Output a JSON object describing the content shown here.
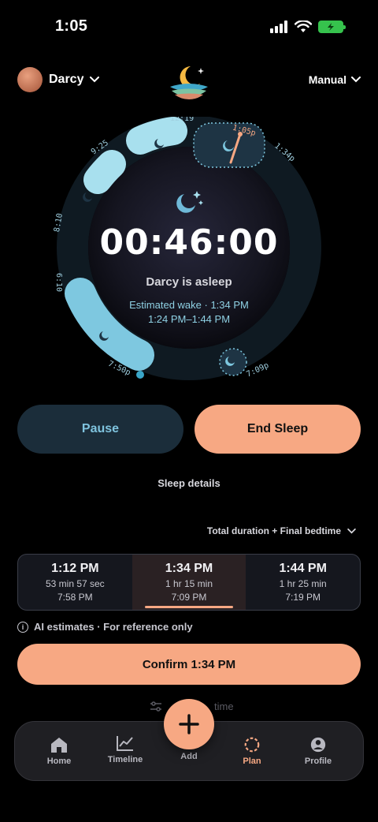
{
  "status_bar": {
    "time": "1:05"
  },
  "header": {
    "user_name": "Darcy",
    "mode": "Manual"
  },
  "dial": {
    "labels": [
      "12:19",
      "1:05p",
      "1:34p",
      "9:25",
      "8:10",
      "6:10",
      "7:50p",
      "7:09p"
    ]
  },
  "center": {
    "timer": "00:46:00",
    "status": "Darcy is asleep",
    "estimate_line1": "Estimated wake · 1:34 PM",
    "estimate_line2": "1:24 PM–1:44 PM"
  },
  "buttons": {
    "pause": "Pause",
    "end_sleep": "End Sleep",
    "sleep_details": "Sleep details",
    "confirm": "Confirm 1:34 PM"
  },
  "duration_selector": "Total duration + Final bedtime",
  "options": [
    {
      "time": "1:12 PM",
      "duration": "53 min 57 sec",
      "bedtime": "7:58 PM"
    },
    {
      "time": "1:34 PM",
      "duration": "1 hr 15 min",
      "bedtime": "7:09 PM"
    },
    {
      "time": "1:44 PM",
      "duration": "1 hr 25 min",
      "bedtime": "7:19 PM"
    }
  ],
  "ai_note": "AI estimates · For reference only",
  "faded_row": "time",
  "tabbar": {
    "home": "Home",
    "timeline": "Timeline",
    "add": "Add",
    "plan": "Plan",
    "profile": "Profile"
  },
  "colors": {
    "accent": "#f7a883",
    "sleep_blue": "#8fd1e4",
    "dial_ring": "#0f1a22"
  }
}
